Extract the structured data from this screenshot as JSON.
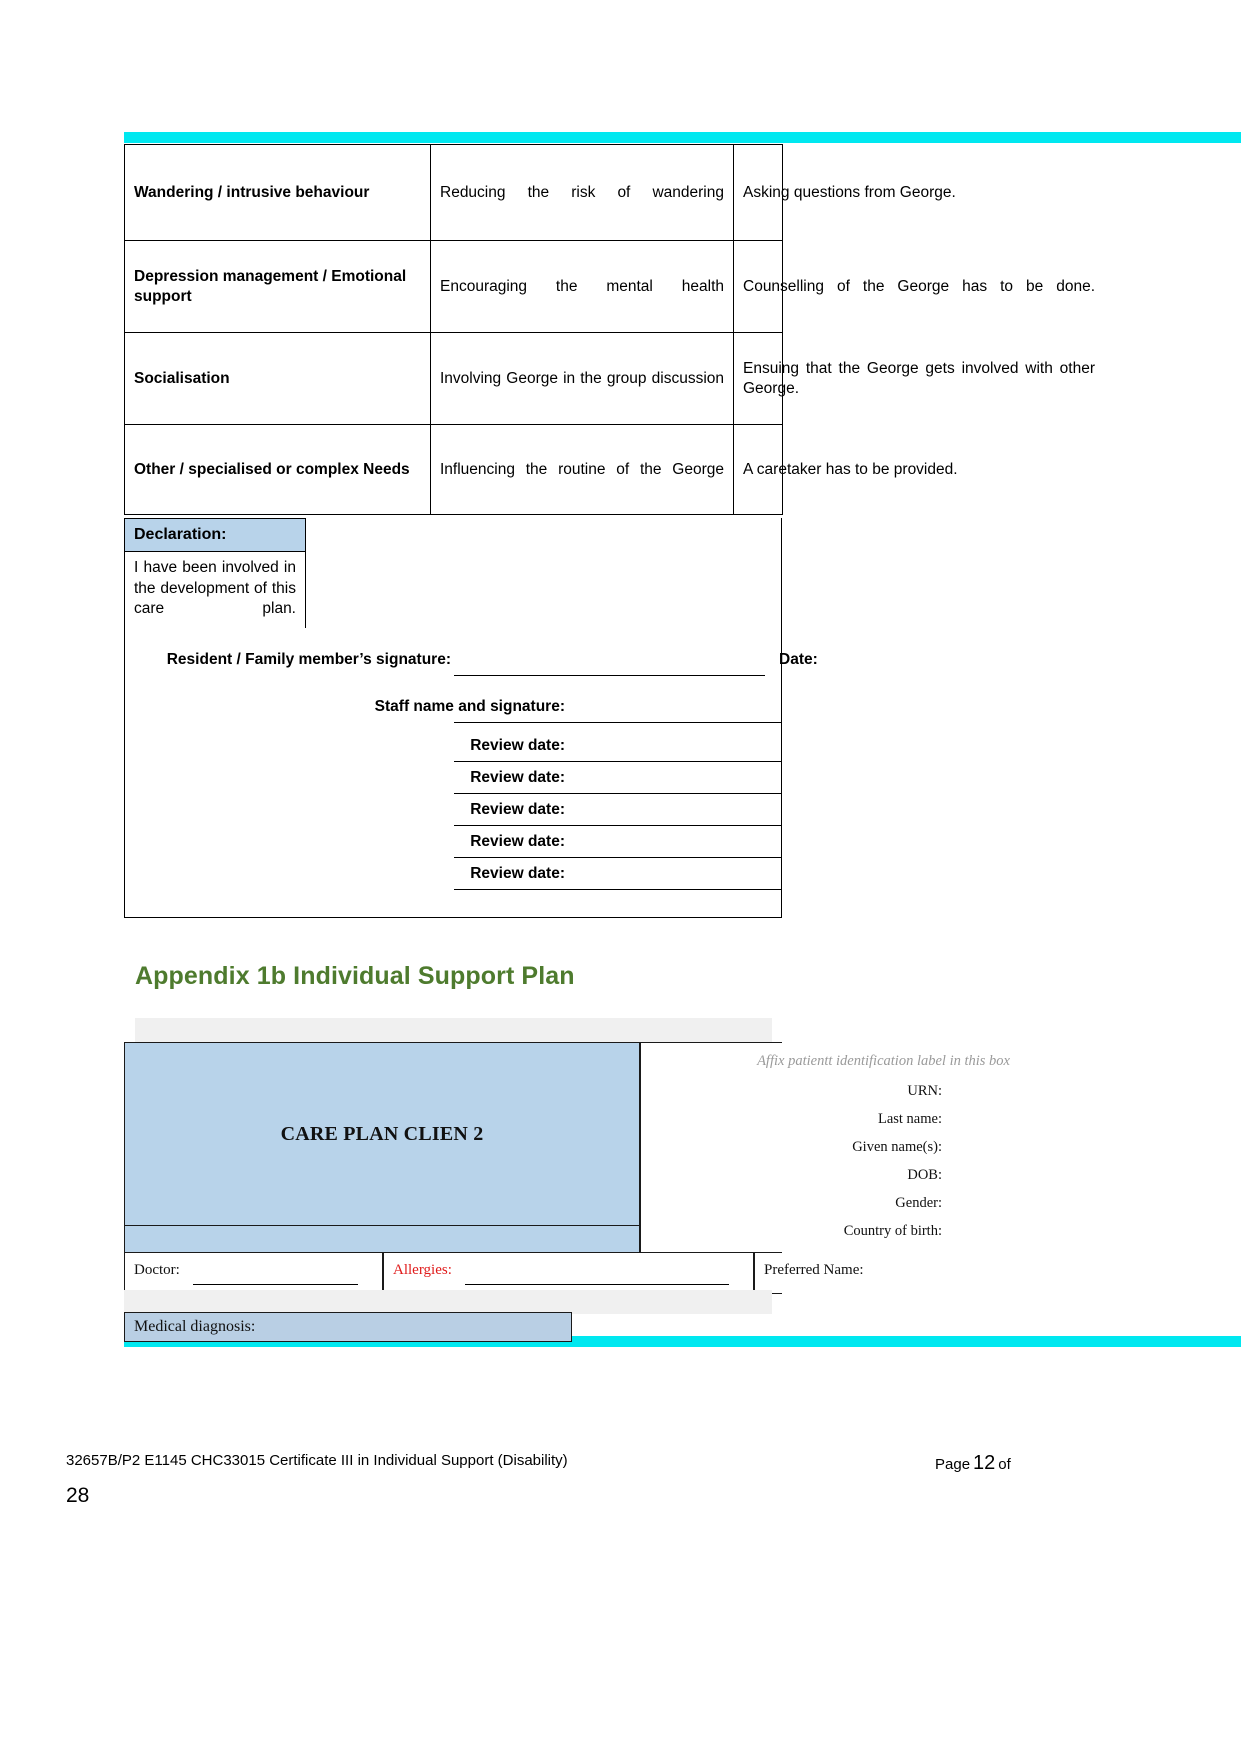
{
  "bands": {
    "accent_color": "#00e8f0",
    "grey_color": "#f0f0f0"
  },
  "care_table": {
    "rows": [
      {
        "need": "Wandering / intrusive behaviour",
        "goal": "Reducing the risk of wandering",
        "action": "Asking questions from George."
      },
      {
        "need": "Depression management / Emotional support",
        "goal": "Encouraging the mental health",
        "action": "Counselling of the George has to be done."
      },
      {
        "need": "Socialisation",
        "goal": "Involving George in the group discussion",
        "action": "Ensuing that the George gets involved with other George."
      },
      {
        "need": "Other / specialised or complex Needs",
        "goal": "Influencing the routine of the George",
        "action": "A caretaker has to be provided."
      }
    ]
  },
  "declaration": {
    "title": "Declaration:",
    "body": "I have been involved in the development of this care plan."
  },
  "signatures": {
    "resident_label": "Resident / Family member’s signature:",
    "date_label": "Date:",
    "staff_label": "Staff name and signature:",
    "review_label_1": "Review date:",
    "review_label_2": "Review date:",
    "review_label_3": "Review date:",
    "review_label_4": "Review date:",
    "review_label_5": "Review date:"
  },
  "appendix": {
    "heading": "Appendix 1b Individual Support Plan",
    "heading_color": "#4e7b2e"
  },
  "care_plan_header": {
    "title": "CARE PLAN CLIEN 2",
    "title_bg": "#b8d3ea",
    "affix_note": "Affix patientt identification label in this box",
    "fields": [
      "URN:",
      "Last name:",
      "Given name(s):",
      "DOB:",
      "Gender:",
      "Country of birth:"
    ]
  },
  "info_row": {
    "doctor_label": "Doctor:",
    "allergies_label": "Allergies:",
    "allergies_color": "#e01b1b",
    "preferred_name_label": "Preferred Name:"
  },
  "medical_diagnosis": {
    "label": "Medical diagnosis:",
    "bg": "#b9cfe4"
  },
  "footer": {
    "left": "32657B/P2 E1145 CHC33015 Certificate III in Individual Support (Disability)",
    "page_word": "Page",
    "page_number": "12",
    "of_word": "of",
    "page_continuation": "28"
  }
}
